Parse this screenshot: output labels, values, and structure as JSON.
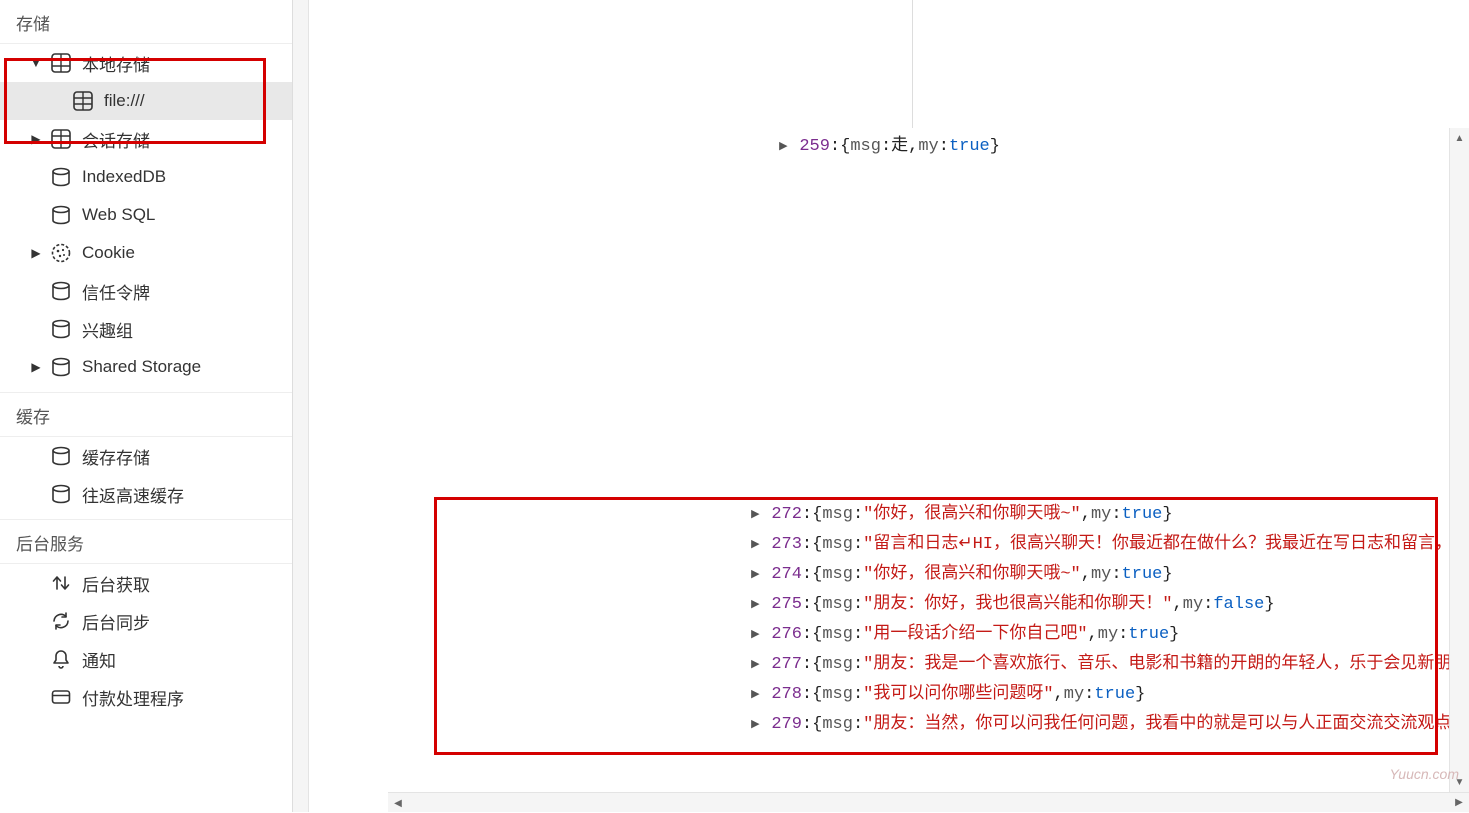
{
  "sidebar": {
    "sections": {
      "storage": "存储",
      "cache": "缓存",
      "services": "后台服务"
    },
    "storage": {
      "local": "本地存储",
      "local_child": "file:///",
      "session": "会话存储",
      "indexeddb": "IndexedDB",
      "websql": "Web SQL",
      "cookie": "Cookie",
      "trust": "信任令牌",
      "interest": "兴趣组",
      "shared": "Shared Storage"
    },
    "cache": {
      "cache_storage": "缓存存储",
      "bfcache": "往返高速缓存"
    },
    "services": {
      "bgfetch": "后台获取",
      "bgsync": "后台同步",
      "notif": "通知",
      "payment": "付款处理程序"
    }
  },
  "entries": [
    {
      "i": "259",
      "msg": "走",
      "my": "true",
      "cut": true
    },
    {
      "i": "272",
      "msg": "你好，很高兴和你聊天哦~",
      "my": "true"
    },
    {
      "i": "273",
      "msg": "留言和日志↵HI，很高兴聊天！你最近都在做什么？我最近在写日志和留言，好",
      "truncate": true
    },
    {
      "i": "274",
      "msg": "你好，很高兴和你聊天哦~",
      "my": "true"
    },
    {
      "i": "275",
      "msg": "朋友：你好，我也很高兴能和你聊天！",
      "my": "false"
    },
    {
      "i": "276",
      "msg": "用一段话介绍一下你自己吧",
      "my": "true"
    },
    {
      "i": "277",
      "msg": "朋友：我是一个喜欢旅行、音乐、电影和书籍的开朗的年轻人，乐于会见新朋友",
      "truncate": true
    },
    {
      "i": "278",
      "msg": "我可以问你哪些问题呀",
      "my": "true"
    },
    {
      "i": "279",
      "msg": "朋友：当然，你可以问我任何问题，我看中的就是可以与人正面交流交流观点，",
      "truncate": true
    }
  ],
  "watermark": "Yuucn.com"
}
